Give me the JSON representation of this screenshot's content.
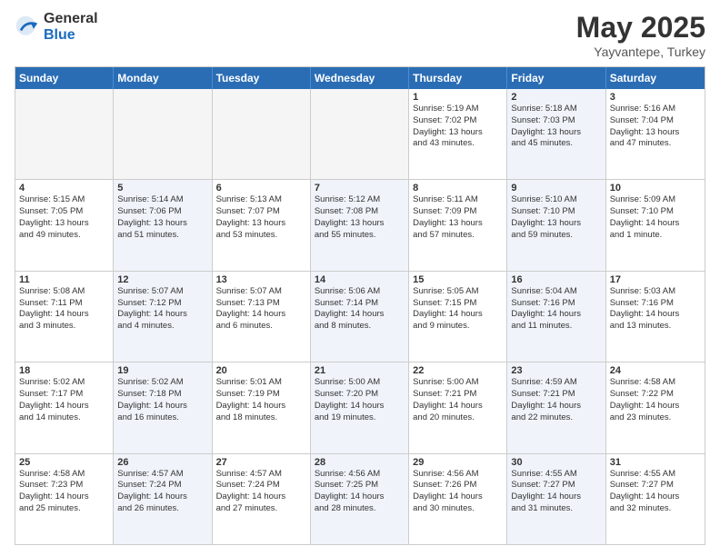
{
  "header": {
    "logo_general": "General",
    "logo_blue": "Blue",
    "month_title": "May 2025",
    "location": "Yayvantepe, Turkey"
  },
  "days_of_week": [
    "Sunday",
    "Monday",
    "Tuesday",
    "Wednesday",
    "Thursday",
    "Friday",
    "Saturday"
  ],
  "rows": [
    [
      {
        "day": "",
        "empty": true
      },
      {
        "day": "",
        "empty": true
      },
      {
        "day": "",
        "empty": true
      },
      {
        "day": "",
        "empty": true
      },
      {
        "day": "1",
        "line1": "Sunrise: 5:19 AM",
        "line2": "Sunset: 7:02 PM",
        "line3": "Daylight: 13 hours",
        "line4": "and 43 minutes."
      },
      {
        "day": "2",
        "line1": "Sunrise: 5:18 AM",
        "line2": "Sunset: 7:03 PM",
        "line3": "Daylight: 13 hours",
        "line4": "and 45 minutes.",
        "shaded": true
      },
      {
        "day": "3",
        "line1": "Sunrise: 5:16 AM",
        "line2": "Sunset: 7:04 PM",
        "line3": "Daylight: 13 hours",
        "line4": "and 47 minutes."
      }
    ],
    [
      {
        "day": "4",
        "line1": "Sunrise: 5:15 AM",
        "line2": "Sunset: 7:05 PM",
        "line3": "Daylight: 13 hours",
        "line4": "and 49 minutes."
      },
      {
        "day": "5",
        "line1": "Sunrise: 5:14 AM",
        "line2": "Sunset: 7:06 PM",
        "line3": "Daylight: 13 hours",
        "line4": "and 51 minutes.",
        "shaded": true
      },
      {
        "day": "6",
        "line1": "Sunrise: 5:13 AM",
        "line2": "Sunset: 7:07 PM",
        "line3": "Daylight: 13 hours",
        "line4": "and 53 minutes."
      },
      {
        "day": "7",
        "line1": "Sunrise: 5:12 AM",
        "line2": "Sunset: 7:08 PM",
        "line3": "Daylight: 13 hours",
        "line4": "and 55 minutes.",
        "shaded": true
      },
      {
        "day": "8",
        "line1": "Sunrise: 5:11 AM",
        "line2": "Sunset: 7:09 PM",
        "line3": "Daylight: 13 hours",
        "line4": "and 57 minutes."
      },
      {
        "day": "9",
        "line1": "Sunrise: 5:10 AM",
        "line2": "Sunset: 7:10 PM",
        "line3": "Daylight: 13 hours",
        "line4": "and 59 minutes.",
        "shaded": true
      },
      {
        "day": "10",
        "line1": "Sunrise: 5:09 AM",
        "line2": "Sunset: 7:10 PM",
        "line3": "Daylight: 14 hours",
        "line4": "and 1 minute."
      }
    ],
    [
      {
        "day": "11",
        "line1": "Sunrise: 5:08 AM",
        "line2": "Sunset: 7:11 PM",
        "line3": "Daylight: 14 hours",
        "line4": "and 3 minutes."
      },
      {
        "day": "12",
        "line1": "Sunrise: 5:07 AM",
        "line2": "Sunset: 7:12 PM",
        "line3": "Daylight: 14 hours",
        "line4": "and 4 minutes.",
        "shaded": true
      },
      {
        "day": "13",
        "line1": "Sunrise: 5:07 AM",
        "line2": "Sunset: 7:13 PM",
        "line3": "Daylight: 14 hours",
        "line4": "and 6 minutes."
      },
      {
        "day": "14",
        "line1": "Sunrise: 5:06 AM",
        "line2": "Sunset: 7:14 PM",
        "line3": "Daylight: 14 hours",
        "line4": "and 8 minutes.",
        "shaded": true
      },
      {
        "day": "15",
        "line1": "Sunrise: 5:05 AM",
        "line2": "Sunset: 7:15 PM",
        "line3": "Daylight: 14 hours",
        "line4": "and 9 minutes."
      },
      {
        "day": "16",
        "line1": "Sunrise: 5:04 AM",
        "line2": "Sunset: 7:16 PM",
        "line3": "Daylight: 14 hours",
        "line4": "and 11 minutes.",
        "shaded": true
      },
      {
        "day": "17",
        "line1": "Sunrise: 5:03 AM",
        "line2": "Sunset: 7:16 PM",
        "line3": "Daylight: 14 hours",
        "line4": "and 13 minutes."
      }
    ],
    [
      {
        "day": "18",
        "line1": "Sunrise: 5:02 AM",
        "line2": "Sunset: 7:17 PM",
        "line3": "Daylight: 14 hours",
        "line4": "and 14 minutes."
      },
      {
        "day": "19",
        "line1": "Sunrise: 5:02 AM",
        "line2": "Sunset: 7:18 PM",
        "line3": "Daylight: 14 hours",
        "line4": "and 16 minutes.",
        "shaded": true
      },
      {
        "day": "20",
        "line1": "Sunrise: 5:01 AM",
        "line2": "Sunset: 7:19 PM",
        "line3": "Daylight: 14 hours",
        "line4": "and 18 minutes."
      },
      {
        "day": "21",
        "line1": "Sunrise: 5:00 AM",
        "line2": "Sunset: 7:20 PM",
        "line3": "Daylight: 14 hours",
        "line4": "and 19 minutes.",
        "shaded": true
      },
      {
        "day": "22",
        "line1": "Sunrise: 5:00 AM",
        "line2": "Sunset: 7:21 PM",
        "line3": "Daylight: 14 hours",
        "line4": "and 20 minutes."
      },
      {
        "day": "23",
        "line1": "Sunrise: 4:59 AM",
        "line2": "Sunset: 7:21 PM",
        "line3": "Daylight: 14 hours",
        "line4": "and 22 minutes.",
        "shaded": true
      },
      {
        "day": "24",
        "line1": "Sunrise: 4:58 AM",
        "line2": "Sunset: 7:22 PM",
        "line3": "Daylight: 14 hours",
        "line4": "and 23 minutes."
      }
    ],
    [
      {
        "day": "25",
        "line1": "Sunrise: 4:58 AM",
        "line2": "Sunset: 7:23 PM",
        "line3": "Daylight: 14 hours",
        "line4": "and 25 minutes."
      },
      {
        "day": "26",
        "line1": "Sunrise: 4:57 AM",
        "line2": "Sunset: 7:24 PM",
        "line3": "Daylight: 14 hours",
        "line4": "and 26 minutes.",
        "shaded": true
      },
      {
        "day": "27",
        "line1": "Sunrise: 4:57 AM",
        "line2": "Sunset: 7:24 PM",
        "line3": "Daylight: 14 hours",
        "line4": "and 27 minutes."
      },
      {
        "day": "28",
        "line1": "Sunrise: 4:56 AM",
        "line2": "Sunset: 7:25 PM",
        "line3": "Daylight: 14 hours",
        "line4": "and 28 minutes.",
        "shaded": true
      },
      {
        "day": "29",
        "line1": "Sunrise: 4:56 AM",
        "line2": "Sunset: 7:26 PM",
        "line3": "Daylight: 14 hours",
        "line4": "and 30 minutes."
      },
      {
        "day": "30",
        "line1": "Sunrise: 4:55 AM",
        "line2": "Sunset: 7:27 PM",
        "line3": "Daylight: 14 hours",
        "line4": "and 31 minutes.",
        "shaded": true
      },
      {
        "day": "31",
        "line1": "Sunrise: 4:55 AM",
        "line2": "Sunset: 7:27 PM",
        "line3": "Daylight: 14 hours",
        "line4": "and 32 minutes."
      }
    ]
  ]
}
